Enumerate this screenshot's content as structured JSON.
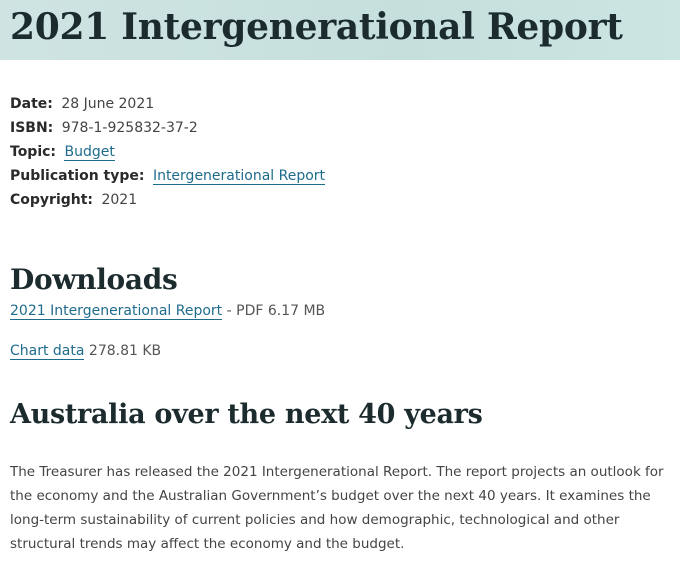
{
  "header": {
    "title": "2021 Intergenerational Report"
  },
  "meta": {
    "date_label": "Date:",
    "date_value": "28 June 2021",
    "isbn_label": "ISBN:",
    "isbn_value": "978-1-925832-37-2",
    "topic_label": "Topic:",
    "topic_link": "Budget",
    "pubtype_label": "Publication type:",
    "pubtype_link": "Intergenerational Report",
    "copyright_label": "Copyright:",
    "copyright_value": "2021"
  },
  "downloads": {
    "heading": "Downloads",
    "items": [
      {
        "link": "2021 Intergenerational Report",
        "info": " - PDF 6.17 MB"
      },
      {
        "link": "Chart data",
        "info": " 278.81 KB"
      }
    ]
  },
  "section": {
    "heading": "Australia over the next 40 years",
    "body": "The Treasurer has released the 2021 Intergenerational Report. The report projects an outlook for the economy and the Australian Government’s budget over the next 40 years. It examines the long-term sustainability of current policies and how demographic, technological and other structural trends may affect the economy and the budget."
  },
  "colors": {
    "banner": "#c5dfdd",
    "link": "#1f6b8c",
    "heading": "#1c2b2e"
  }
}
